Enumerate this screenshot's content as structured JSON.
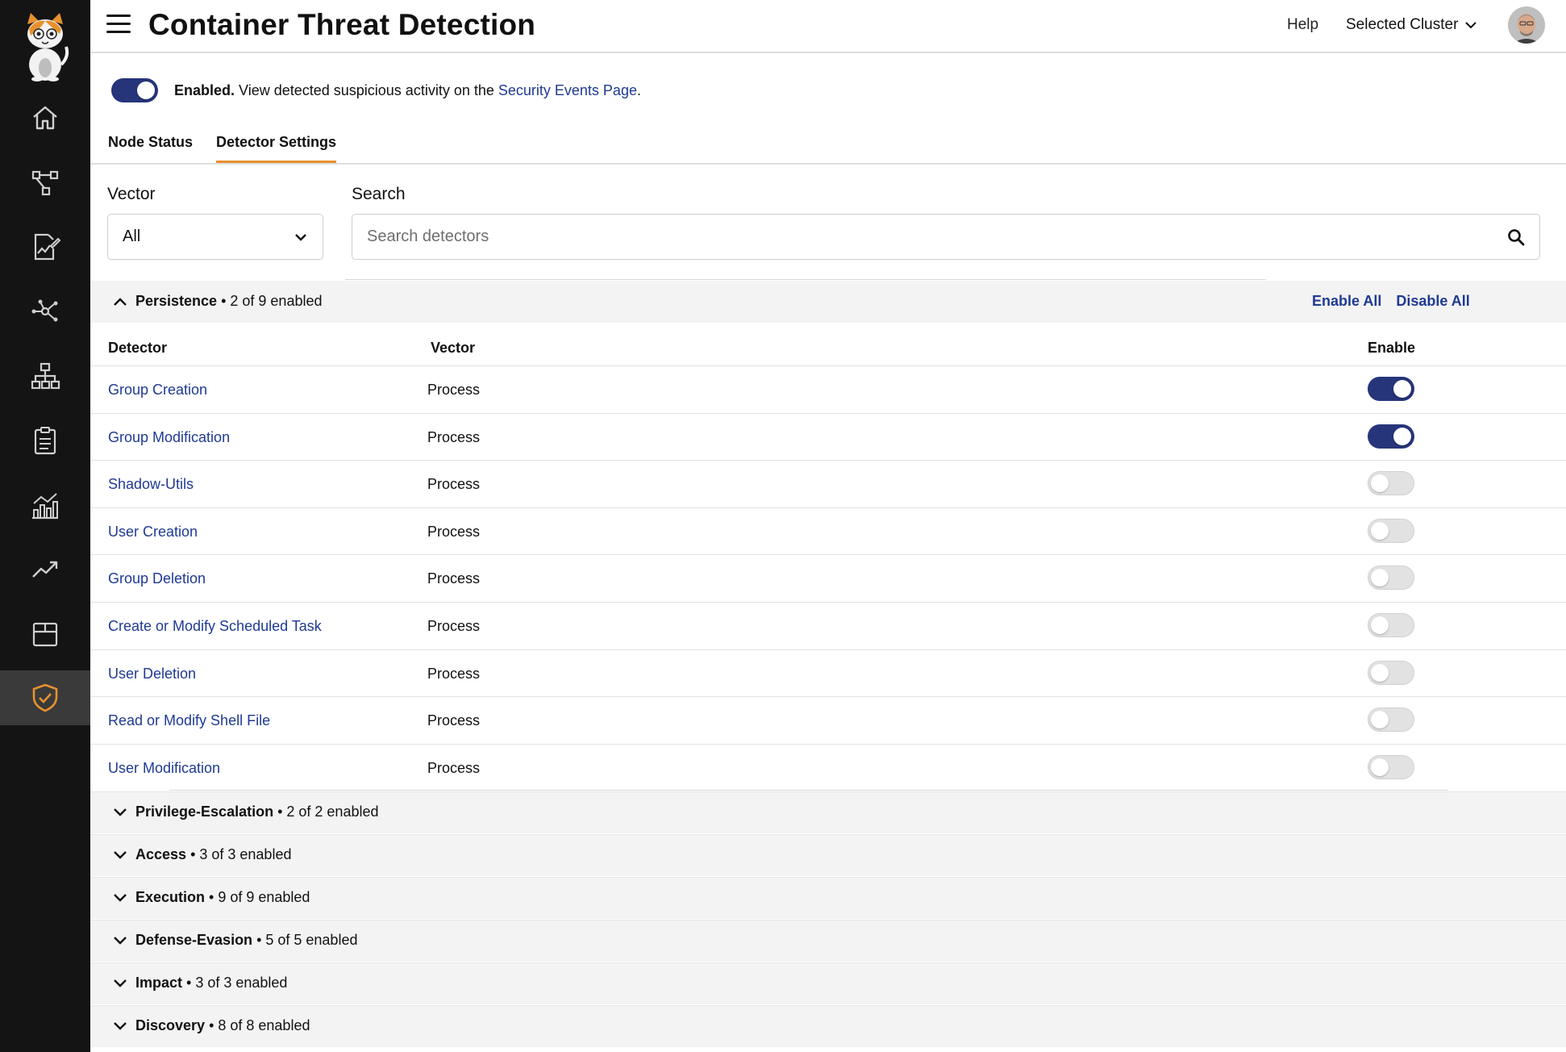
{
  "header": {
    "title": "Container Threat Detection",
    "help": "Help",
    "cluster": "Selected Cluster"
  },
  "sidebar": {
    "items": [
      {
        "icon": "home-icon",
        "active": false
      },
      {
        "icon": "workflow-icon",
        "active": false
      },
      {
        "icon": "report-icon",
        "active": false
      },
      {
        "icon": "network-icon",
        "active": false
      },
      {
        "icon": "hierarchy-icon",
        "active": false
      },
      {
        "icon": "clipboard-icon",
        "active": false
      },
      {
        "icon": "bar-chart-icon",
        "active": false
      },
      {
        "icon": "trend-icon",
        "active": false
      },
      {
        "icon": "package-icon",
        "active": false
      },
      {
        "icon": "shield-check-icon",
        "active": true
      }
    ]
  },
  "status": {
    "enabled": true,
    "bold": "Enabled.",
    "text": " View detected suspicious activity on the ",
    "link": "Security Events Page",
    "suffix": "."
  },
  "tabs": [
    {
      "label": "Node Status",
      "active": false
    },
    {
      "label": "Detector Settings",
      "active": true
    }
  ],
  "filters": {
    "vector_label": "Vector",
    "vector_value": "All",
    "search_label": "Search",
    "search_placeholder": "Search detectors"
  },
  "persistence": {
    "name": "Persistence",
    "count": " • 2 of 9 enabled",
    "enable_all": "Enable All",
    "disable_all": "Disable All",
    "columns": {
      "detector": "Detector",
      "vector": "Vector",
      "enable": "Enable"
    },
    "rows": [
      {
        "detector": "Group Creation",
        "vector": "Process",
        "enabled": true
      },
      {
        "detector": "Group Modification",
        "vector": "Process",
        "enabled": true
      },
      {
        "detector": "Shadow-Utils",
        "vector": "Process",
        "enabled": false
      },
      {
        "detector": "User Creation",
        "vector": "Process",
        "enabled": false
      },
      {
        "detector": "Group Deletion",
        "vector": "Process",
        "enabled": false
      },
      {
        "detector": "Create or Modify Scheduled Task",
        "vector": "Process",
        "enabled": false
      },
      {
        "detector": "User Deletion",
        "vector": "Process",
        "enabled": false
      },
      {
        "detector": "Read or Modify Shell File",
        "vector": "Process",
        "enabled": false
      },
      {
        "detector": "User Modification",
        "vector": "Process",
        "enabled": false
      }
    ]
  },
  "groups": [
    {
      "name": "Privilege-Escalation",
      "count": " • 2 of 2 enabled"
    },
    {
      "name": "Access",
      "count": " • 3 of 3 enabled"
    },
    {
      "name": "Execution",
      "count": " • 9 of 9 enabled"
    },
    {
      "name": "Defense-Evasion",
      "count": " • 5 of 5 enabled"
    },
    {
      "name": "Impact",
      "count": " • 3 of 3 enabled"
    },
    {
      "name": "Discovery",
      "count": " • 8 of 8 enabled"
    }
  ],
  "colors": {
    "accent": "#26357a",
    "link": "#1f3a93",
    "tab_underline": "#e8912d",
    "sidebar_bg": "#141414",
    "active_icon": "#e8912d"
  }
}
